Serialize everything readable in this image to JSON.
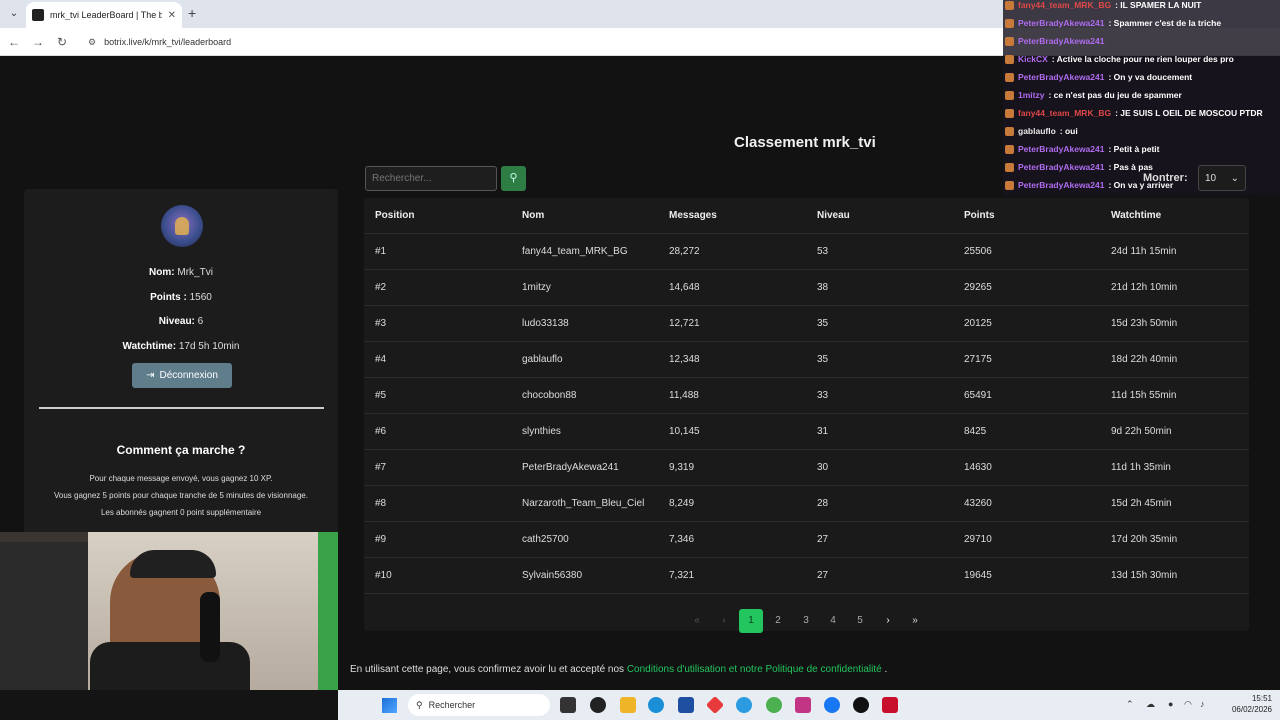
{
  "browser": {
    "tab_title": "mrk_tvi LeaderBoard | The best",
    "url": "botrix.live/k/mrk_tvi/leaderboard"
  },
  "page": {
    "title": "Classement mrk_tvi",
    "search_placeholder": "Rechercher...",
    "show_label": "Montrer:",
    "show_value": "10"
  },
  "profile": {
    "name_label": "Nom:",
    "name_value": "Mrk_Tvi",
    "points_label": "Points :",
    "points_value": "1560",
    "level_label": "Niveau:",
    "level_value": "6",
    "watchtime_label": "Watchtime:",
    "watchtime_value": "17d 5h 10min",
    "logout_label": "Déconnexion"
  },
  "how": {
    "title": "Comment ça marche ?",
    "lines": [
      "Pour chaque message envoyé, vous gagnez 10 XP.",
      "Vous gagnez 5 points pour chaque tranche de 5 minutes de visionnage.",
      "Les abonnés gagnent 0 point supplémentaire"
    ]
  },
  "table": {
    "headers": [
      "Position",
      "Nom",
      "Messages",
      "Niveau",
      "Points",
      "Watchtime"
    ],
    "rows": [
      [
        "#1",
        "fany44_team_MRK_BG",
        "28,272",
        "53",
        "25506",
        "24d 11h 15min"
      ],
      [
        "#2",
        "1mitzy",
        "14,648",
        "38",
        "29265",
        "21d 12h 10min"
      ],
      [
        "#3",
        "ludo33138",
        "12,721",
        "35",
        "20125",
        "15d 23h 50min"
      ],
      [
        "#4",
        "gablauflo",
        "12,348",
        "35",
        "27175",
        "18d 22h 40min"
      ],
      [
        "#5",
        "chocobon88",
        "11,488",
        "33",
        "65491",
        "11d 15h 55min"
      ],
      [
        "#6",
        "slynthies",
        "10,145",
        "31",
        "8425",
        "9d 22h 50min"
      ],
      [
        "#7",
        "PeterBradyAkewa241",
        "9,319",
        "30",
        "14630",
        "11d 1h 35min"
      ],
      [
        "#8",
        "Narzaroth_Team_Bleu_Ciel",
        "8,249",
        "28",
        "43260",
        "15d 2h 45min"
      ],
      [
        "#9",
        "cath25700",
        "7,346",
        "27",
        "29710",
        "17d 20h 35min"
      ],
      [
        "#10",
        "Sylvain56380",
        "7,321",
        "27",
        "19645",
        "13d 15h 30min"
      ]
    ]
  },
  "pagination": {
    "pages": [
      "1",
      "2",
      "3",
      "4",
      "5"
    ],
    "active": "1"
  },
  "consent": {
    "prefix": "En utilisant cette page, vous confirmez avoir lu et accepté nos",
    "link": "Conditions d'utilisation et notre Politique de confidentialité",
    "suffix": "."
  },
  "chat": [
    {
      "user": "fany44_team_MRK_BG",
      "text": ": IL SPAMER LA NUIT",
      "color": "#e04848"
    },
    {
      "user": "PeterBradyAkewa241",
      "text": ": Spammer c'est de la triche",
      "color": "#b06cf0"
    },
    {
      "user": "PeterBradyAkewa241",
      "text": "",
      "color": "#b06cf0"
    },
    {
      "user": "KickCX",
      "text": ": Active la cloche pour ne rien louper des pro",
      "color": "#b06cf0"
    },
    {
      "user": "PeterBradyAkewa241",
      "text": ": On y va doucement",
      "color": "#b06cf0"
    },
    {
      "user": "1mitzy",
      "text": ": ce n'est pas du jeu de spammer",
      "color": "#b06cf0"
    },
    {
      "user": "fany44_team_MRK_BG",
      "text": ": JE SUIS L OEIL DE MOSCOU PTDR",
      "color": "#e04848"
    },
    {
      "user": "gablauflo",
      "text": ": oui",
      "color": "#e8e8e8"
    },
    {
      "user": "PeterBradyAkewa241",
      "text": ": Petit à petit",
      "color": "#b06cf0"
    },
    {
      "user": "PeterBradyAkewa241",
      "text": ": Pas à pas",
      "color": "#b06cf0"
    },
    {
      "user": "PeterBradyAkewa241",
      "text": ": On va y arriver",
      "color": "#b06cf0"
    }
  ],
  "taskbar": {
    "search_label": "Rechercher",
    "time": "15:51",
    "date": "06/02/2026"
  },
  "colors": {
    "accent": "#22c55e",
    "logout": "#607d8b"
  }
}
